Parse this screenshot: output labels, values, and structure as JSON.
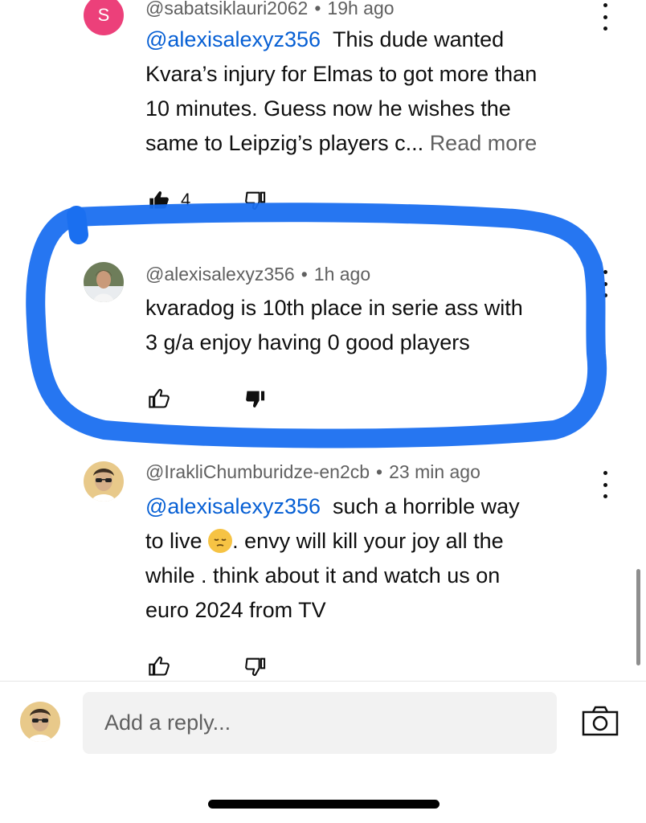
{
  "comments": [
    {
      "avatar_letter": "S",
      "author": "@sabatsiklauri2062",
      "time": "19h ago",
      "mention": "@alexisalexyz356",
      "text_lines": [
        "This dude wanted",
        "Kvara’s injury for Elmas to got more than",
        "10 minutes. Guess now he wishes the",
        "same to Leipzig’s players c..."
      ],
      "read_more": "Read more",
      "likes": "4",
      "liked": true
    },
    {
      "author": "@alexisalexyz356",
      "time": "1h ago",
      "text_lines": [
        "kvaradog is 10th place in serie ass with",
        "3 g/a enjoy having 0 good players"
      ],
      "disliked": true
    },
    {
      "author": "@IrakliChumburidze-en2cb",
      "time": "23 min ago",
      "mention": "@alexisalexyz356",
      "text_lines": [
        "such a horrible way",
        "to live",
        ". envy will kill your joy all the",
        "while . think about it and watch us on",
        "euro 2024 from TV"
      ]
    }
  ],
  "reply": {
    "placeholder": "Add a reply..."
  },
  "icons": {
    "like": "thumb-up-icon",
    "dislike": "thumb-down-icon",
    "more": "more-vertical-icon",
    "camera": "camera-icon",
    "emoji": "pensive-face-emoji"
  },
  "colors": {
    "mention": "#065fd4",
    "highlight_marker": "#1a6ff0",
    "avatar_s": "#ec407a"
  }
}
